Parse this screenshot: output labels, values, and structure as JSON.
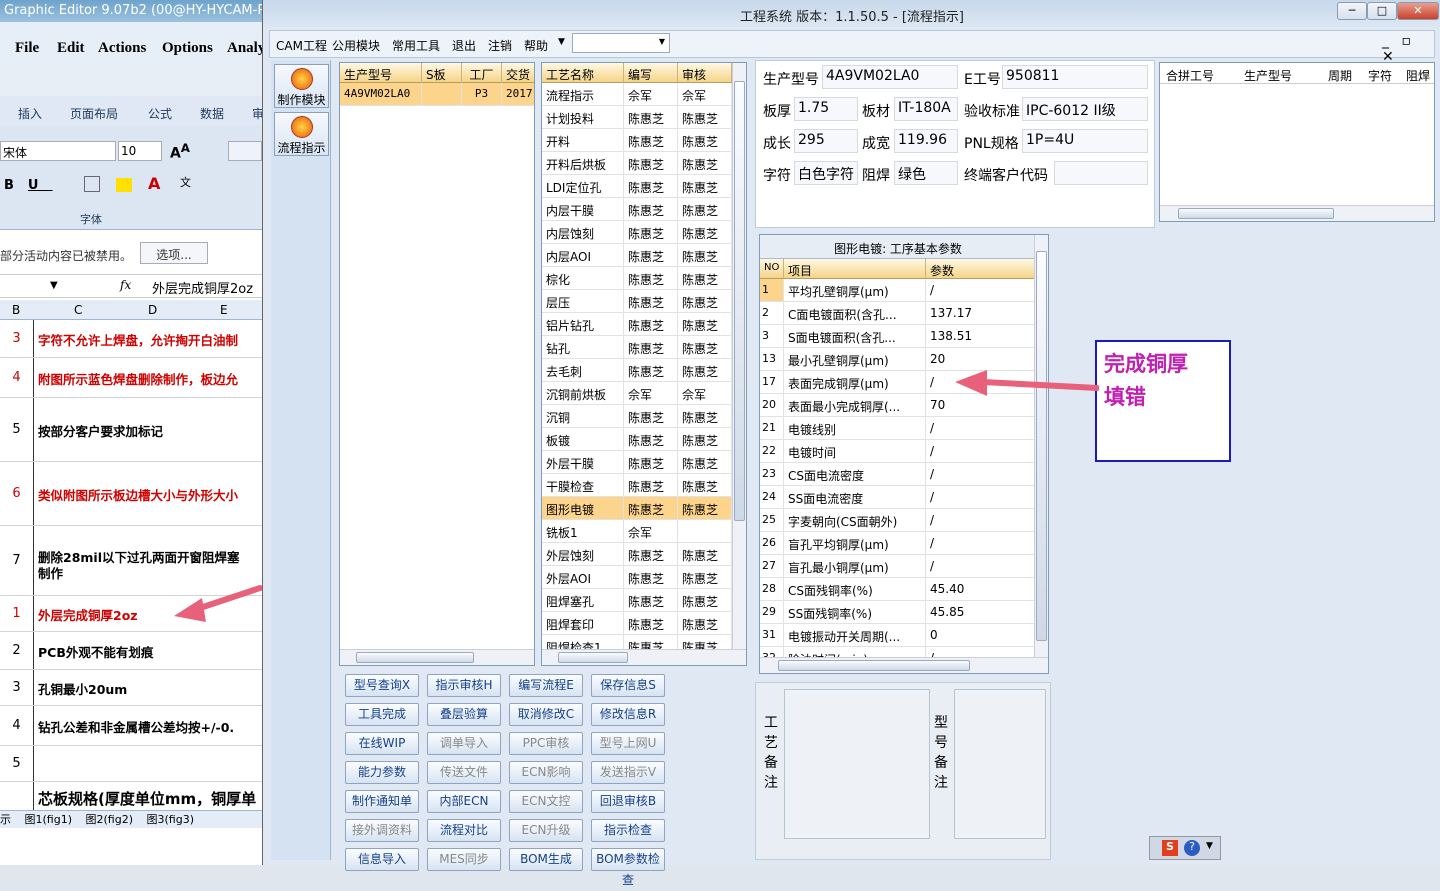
{
  "excel": {
    "title": "Graphic Editor 9.07b2 (00@HY-HYCAM-P",
    "menu": [
      "File",
      "Edit",
      "Actions",
      "Options",
      "Analy"
    ],
    "ribbon_tabs": [
      "插入",
      "页面布局",
      "公式",
      "数据",
      "审"
    ],
    "font_name": "宋体",
    "font_size": "10",
    "font_group": "字体",
    "warning": "部分活动内容已被禁用。",
    "options_btn": "选项...",
    "fx": "fx",
    "formula": "外层完成铜厚2oz",
    "cols": [
      "B",
      "C",
      "D",
      "E"
    ],
    "rows": [
      {
        "n": "3",
        "t": "字符不允许上焊盘，允许掏开白油制",
        "red": true
      },
      {
        "n": "4",
        "t": "附图所示蓝色焊盘删除制作，板边允",
        "red": true
      },
      {
        "n": "5",
        "t": "按部分客户要求加标记",
        "red": false
      },
      {
        "n": "6",
        "t": "类似附图所示板边槽大小与外形大小",
        "red": true
      },
      {
        "n": "7",
        "t": "删除28mil以下过孔两面开窗阻焊塞",
        "t2": "制作",
        "red": false
      },
      {
        "n": "1",
        "t": "外层完成铜厚2oz",
        "red": true
      },
      {
        "n": "2",
        "t": "PCB外观不能有划痕",
        "red": false
      },
      {
        "n": "3",
        "t": "孔铜最小20um",
        "red": false
      },
      {
        "n": "4",
        "t": "钻孔公差和非金属槽公差均按+/-0.",
        "red": false
      },
      {
        "n": "5",
        "t": "",
        "red": false
      },
      {
        "n": "",
        "t": "芯板规格(厚度单位mm，铜厚单",
        "red": false
      }
    ],
    "sheets": [
      "示",
      "图1(fig1)",
      "图2(fig2)",
      "图3(fig3)"
    ]
  },
  "main": {
    "title": "工程系统   版本：1.1.50.5 - [流程指示]",
    "menu": [
      "CAM工程",
      "公用模块",
      "常用工具",
      "退出",
      "注销",
      "帮助"
    ],
    "side_buttons": [
      "制作模块",
      "流程指示"
    ],
    "order_grid": {
      "headers": [
        "生产型号",
        "S板",
        "工厂",
        "交货"
      ],
      "row": [
        "4A9VM02LA0",
        "",
        "P3",
        "2017."
      ]
    },
    "process_grid": {
      "headers": [
        "工艺名称",
        "编写",
        "审核"
      ],
      "rows": [
        [
          "流程指示",
          "佘军",
          "佘军"
        ],
        [
          "计划投料",
          "陈惠芝",
          "陈惠芝"
        ],
        [
          "开料",
          "陈惠芝",
          "陈惠芝"
        ],
        [
          "开料后烘板",
          "陈惠芝",
          "陈惠芝"
        ],
        [
          "LDI定位孔",
          "陈惠芝",
          "陈惠芝"
        ],
        [
          "内层干膜",
          "陈惠芝",
          "陈惠芝"
        ],
        [
          "内层蚀刻",
          "陈惠芝",
          "陈惠芝"
        ],
        [
          "内层AOI",
          "陈惠芝",
          "陈惠芝"
        ],
        [
          "棕化",
          "陈惠芝",
          "陈惠芝"
        ],
        [
          "层压",
          "陈惠芝",
          "陈惠芝"
        ],
        [
          "铝片钻孔",
          "陈惠芝",
          "陈惠芝"
        ],
        [
          "钻孔",
          "陈惠芝",
          "陈惠芝"
        ],
        [
          "去毛刺",
          "陈惠芝",
          "陈惠芝"
        ],
        [
          "沉铜前烘板",
          "佘军",
          "佘军"
        ],
        [
          "沉铜",
          "陈惠芝",
          "陈惠芝"
        ],
        [
          "板镀",
          "陈惠芝",
          "陈惠芝"
        ],
        [
          "外层干膜",
          "陈惠芝",
          "陈惠芝"
        ],
        [
          "干膜检查",
          "陈惠芝",
          "陈惠芝"
        ],
        [
          "图形电镀",
          "陈惠芝",
          "陈惠芝"
        ],
        [
          "铣板1",
          "佘军",
          ""
        ],
        [
          "外层蚀刻",
          "陈惠芝",
          "陈惠芝"
        ],
        [
          "外层AOI",
          "陈惠芝",
          "陈惠芝"
        ],
        [
          "阻焊塞孔",
          "陈惠芝",
          "陈惠芝"
        ],
        [
          "阻焊套印",
          "陈惠芝",
          "陈惠芝"
        ],
        [
          "阻焊检查1",
          "陈惠芝",
          "陈惠芝"
        ]
      ],
      "selected": 18
    },
    "info": {
      "model_label": "生产型号",
      "model": "4A9VM02LA0",
      "eno_label": "E工号",
      "eno": "950811",
      "thick_label": "板厚",
      "thick": "1.75",
      "mat_label": "板材",
      "mat": "IT-180A",
      "std_label": "验收标准",
      "std": "IPC-6012 II级",
      "len_label": "成长",
      "len": "295",
      "wid_label": "成宽",
      "wid": "119.96",
      "pnl_label": "PNL规格",
      "pnl": "1P=4U",
      "char_label": "字符",
      "char": "白色字符",
      "mask_label": "阻焊",
      "mask": "绿色",
      "cust_label": "终端客户代码",
      "cust": ""
    },
    "merge_headers": [
      "合拼工号",
      "生产型号",
      "周期",
      "字符",
      "阻焊"
    ],
    "params": {
      "title": "图形电镀: 工序基本参数",
      "headers": [
        "NO",
        "项目",
        "参数"
      ],
      "rows": [
        [
          "1",
          "平均孔壁铜厚(μm)",
          "/"
        ],
        [
          "2",
          "C面电镀面积(含孔...",
          "137.17"
        ],
        [
          "3",
          "S面电镀面积(含孔...",
          "138.51"
        ],
        [
          "13",
          "最小孔壁铜厚(μm)",
          "20"
        ],
        [
          "17",
          "表面完成铜厚(μm)",
          "/"
        ],
        [
          "20",
          "表面最小完成铜厚(...",
          "70"
        ],
        [
          "21",
          "电镀线别",
          "/"
        ],
        [
          "22",
          "电镀时间",
          "/"
        ],
        [
          "23",
          "CS面电流密度",
          "/"
        ],
        [
          "24",
          "SS面电流密度",
          "/"
        ],
        [
          "25",
          "字麦朝向(CS面朝外)",
          "/"
        ],
        [
          "26",
          "盲孔平均铜厚(μm)",
          "/"
        ],
        [
          "27",
          "盲孔最小铜厚(μm)",
          "/"
        ],
        [
          "28",
          "CS面残铜率(%)",
          "45.40"
        ],
        [
          "29",
          "SS面残铜率(%)",
          "45.85"
        ],
        [
          "31",
          "电镀振动开关周期(...",
          "0"
        ],
        [
          "32",
          "除油时间(min)",
          "/"
        ]
      ]
    },
    "callout": "完成铜厚\n填错",
    "buttons": [
      [
        "型号查询X",
        "指示审核H",
        "编写流程E",
        "保存信息S"
      ],
      [
        "工具完成",
        "叠层验算",
        "取消修改C",
        "修改信息R"
      ],
      [
        "在线WIP",
        "调单导入",
        "PPC审核",
        "型号上网U"
      ],
      [
        "能力参数",
        "传送文件",
        "ECN影响",
        "发送指示V"
      ],
      [
        "制作通知单",
        "内部ECN",
        "ECN文控",
        "回退审核B"
      ],
      [
        "接外调资料",
        "流程对比",
        "ECN升级",
        "指示检查"
      ],
      [
        "信息导入",
        "MES同步",
        "BOM生成",
        "BOM参数检查"
      ]
    ],
    "disabled_buttons": [
      "调单导入",
      "PPC审核",
      "型号上网U",
      "传送文件",
      "ECN影响",
      "发送指示V",
      "ECN文控",
      "接外调资料",
      "ECN升级",
      "MES同步"
    ],
    "note_left": "工艺备注",
    "note_right": "型号备注"
  },
  "colors": {
    "accent": "#e8607a",
    "callout": "#c020b0",
    "selected_row": "#fcd48c",
    "header_gold": "#f5d488"
  }
}
